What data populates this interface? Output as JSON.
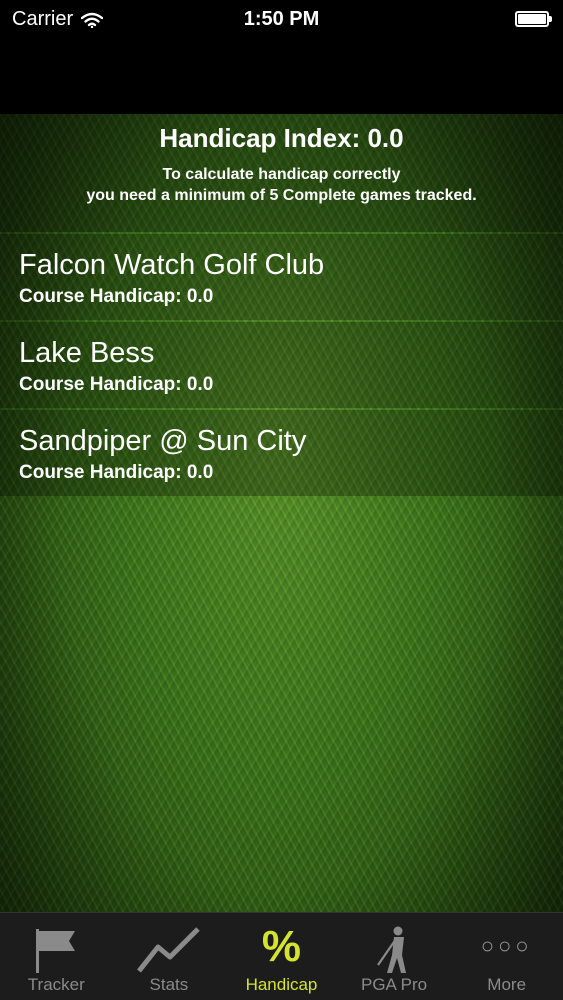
{
  "status_bar": {
    "carrier": "Carrier",
    "time": "1:50 PM"
  },
  "header": {
    "title": "Handicap Index: 0.0",
    "note_line1": "To calculate handicap correctly",
    "note_line2": "you need a minimum of 5 Complete games tracked."
  },
  "courses": [
    {
      "name": "Falcon Watch Golf Club",
      "handicap": "Course Handicap: 0.0"
    },
    {
      "name": "Lake Bess",
      "handicap": "Course Handicap: 0.0"
    },
    {
      "name": "Sandpiper @ Sun City",
      "handicap": "Course Handicap: 0.0"
    }
  ],
  "tabs": [
    {
      "label": "Tracker",
      "icon": "flag-icon",
      "active": false
    },
    {
      "label": "Stats",
      "icon": "line-chart-icon",
      "active": false
    },
    {
      "label": "Handicap",
      "icon": "percent-icon",
      "active": true
    },
    {
      "label": "PGA Pro",
      "icon": "golfer-icon",
      "active": false
    },
    {
      "label": "More",
      "icon": "more-dots-icon",
      "active": false
    }
  ],
  "colors": {
    "active_tab": "#d4e42c",
    "inactive_tab": "#8a8a8a",
    "tab_bar_bg": "#1c1c1c"
  }
}
